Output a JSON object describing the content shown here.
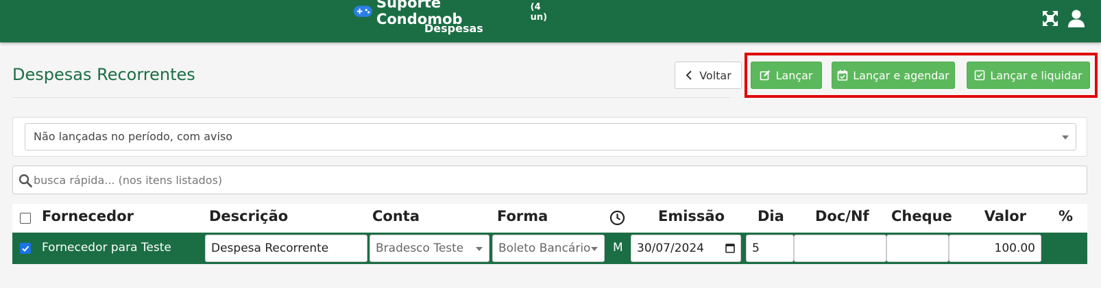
{
  "header": {
    "app_name": "Suporte Condomob",
    "units": "(4 un)",
    "section": "Despesas",
    "icons": [
      "gamepad-icon",
      "expand-icon",
      "user-icon"
    ]
  },
  "page": {
    "title": "Despesas Recorrentes"
  },
  "actions": {
    "back_label": "Voltar",
    "launch_label": "Lançar",
    "launch_schedule_label": "Lançar e agendar",
    "launch_settle_label": "Lançar e liquidar"
  },
  "filter": {
    "selected": "Não lançadas no período, com aviso"
  },
  "search": {
    "placeholder": "busca rápida... (nos itens listados)"
  },
  "table": {
    "columns": {
      "fornecedor": "Fornecedor",
      "descricao": "Descrição",
      "conta": "Conta",
      "forma": "Forma",
      "emissao": "Emissão",
      "dia": "Dia",
      "doc": "Doc/Nf",
      "cheque": "Cheque",
      "valor": "Valor",
      "percent": "%"
    },
    "rows": [
      {
        "checked": true,
        "fornecedor": "Fornecedor para Teste",
        "descricao": "Despesa Recorrente",
        "conta": "Bradesco Teste",
        "forma": "Boleto Bancário",
        "flag": "M",
        "emissao": "30/07/2024",
        "dia": "5",
        "doc": "",
        "cheque": "",
        "valor": "100.00"
      }
    ]
  },
  "colors": {
    "primary_green": "#1b6e44",
    "button_green": "#5cb85c",
    "highlight_red": "#e00000",
    "checkbox_blue": "#1a73e8"
  }
}
